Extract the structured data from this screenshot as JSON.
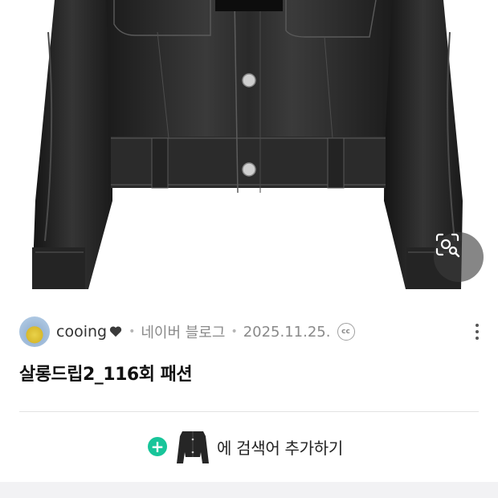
{
  "hero": {
    "image": "black-leather-jacket-photo"
  },
  "post": {
    "author": "cooing",
    "source": "네이버 블로그",
    "date": "2025.11.25.",
    "license_badge": "cc",
    "title": "살롱드립2_116회 패션"
  },
  "search": {
    "label": "에 검색어 추가하기"
  },
  "icons": {
    "lens": "image-search-lens-icon",
    "heart": "heart-icon",
    "more": "more-vertical-icon",
    "plus": "plus-icon"
  },
  "colors": {
    "accent": "#18c59a",
    "muted": "#8a8a8a"
  }
}
